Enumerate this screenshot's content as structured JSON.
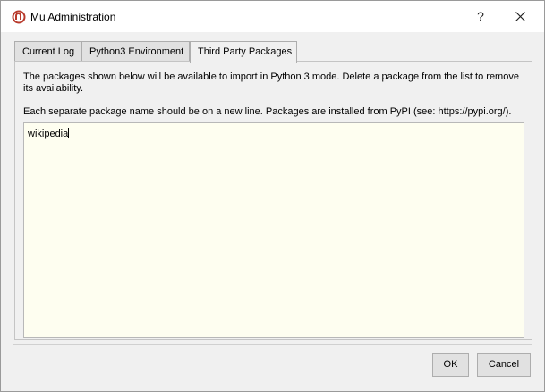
{
  "window": {
    "title": "Mu Administration",
    "help_label": "?",
    "icon": "mu-logo-icon"
  },
  "tabs": [
    {
      "label": "Current Log",
      "active": false
    },
    {
      "label": "Python3 Environment",
      "active": false
    },
    {
      "label": "Third Party Packages",
      "active": true
    }
  ],
  "panel": {
    "description": "The packages shown below will be available to import in Python 3 mode. Delete a package from the list to remove its availability.",
    "instructions": "Each separate package name should be on a new line. Packages are installed from PyPI (see: https://pypi.org/).",
    "packages_text": "wikipedia"
  },
  "buttons": {
    "ok_label": "OK",
    "cancel_label": "Cancel"
  },
  "colors": {
    "packages_background": "#fefef0",
    "mu_logo_red": "#c0392b"
  }
}
